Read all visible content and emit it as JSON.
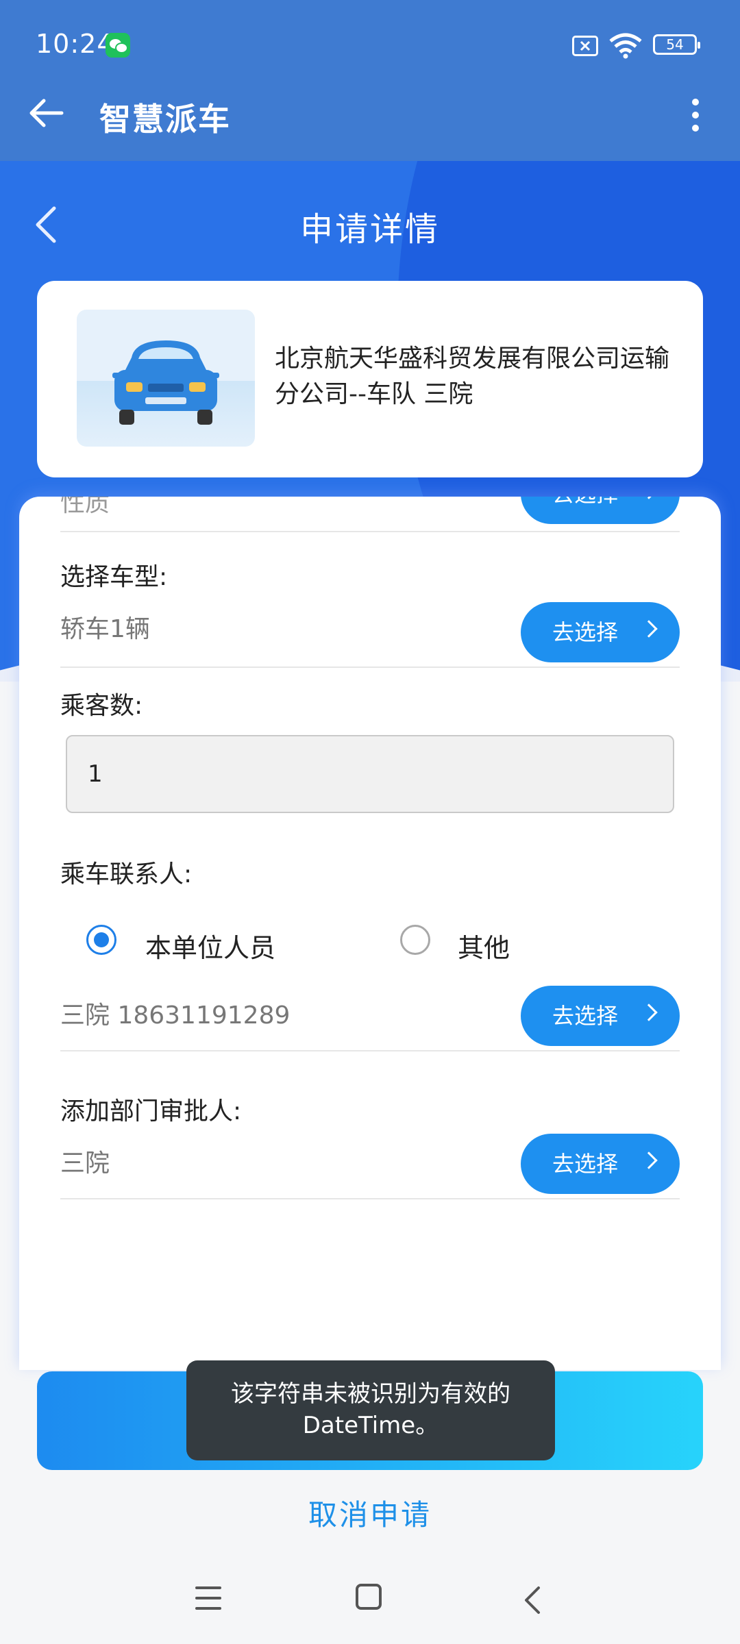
{
  "status_bar": {
    "time": "10:24",
    "battery": "54",
    "icons": [
      "wechat-icon",
      "sim-off-icon",
      "wifi-icon",
      "battery-icon"
    ]
  },
  "app_bar": {
    "title": "智慧派车",
    "back_icon": "arrow-left-icon",
    "menu_icon": "more-vertical-icon"
  },
  "page": {
    "title": "申请详情",
    "back_icon": "chevron-left-icon"
  },
  "company": {
    "name": "北京航天华盛科贸发展有限公司运输分公司--车队 三院",
    "image_icon": "car-icon"
  },
  "form": {
    "partial_label": "性质",
    "partial_button": "去选择",
    "vehicle_type": {
      "label": "选择车型:",
      "value": "轿车1辆",
      "button": "去选择"
    },
    "passengers": {
      "label": "乘客数:",
      "value": "1"
    },
    "contact": {
      "label": "乘车联系人:",
      "options": [
        {
          "label": "本单位人员",
          "checked": true
        },
        {
          "label": "其他",
          "checked": false
        }
      ],
      "value": "三院 18631191289",
      "button": "去选择"
    },
    "approver": {
      "label": "添加部门审批人:",
      "value": "三院",
      "button": "去选择"
    }
  },
  "toast": {
    "message": "该字符串未被识别为有效的 DateTime。"
  },
  "cancel_label": "取消申请",
  "nav_bar": {
    "icons": [
      "menu-icon",
      "home-icon",
      "back-icon"
    ]
  },
  "colors": {
    "app_bar": "#3f7bd1",
    "hero": "#2a72e8",
    "accent": "#1e90f0",
    "toast": "#343b40"
  }
}
